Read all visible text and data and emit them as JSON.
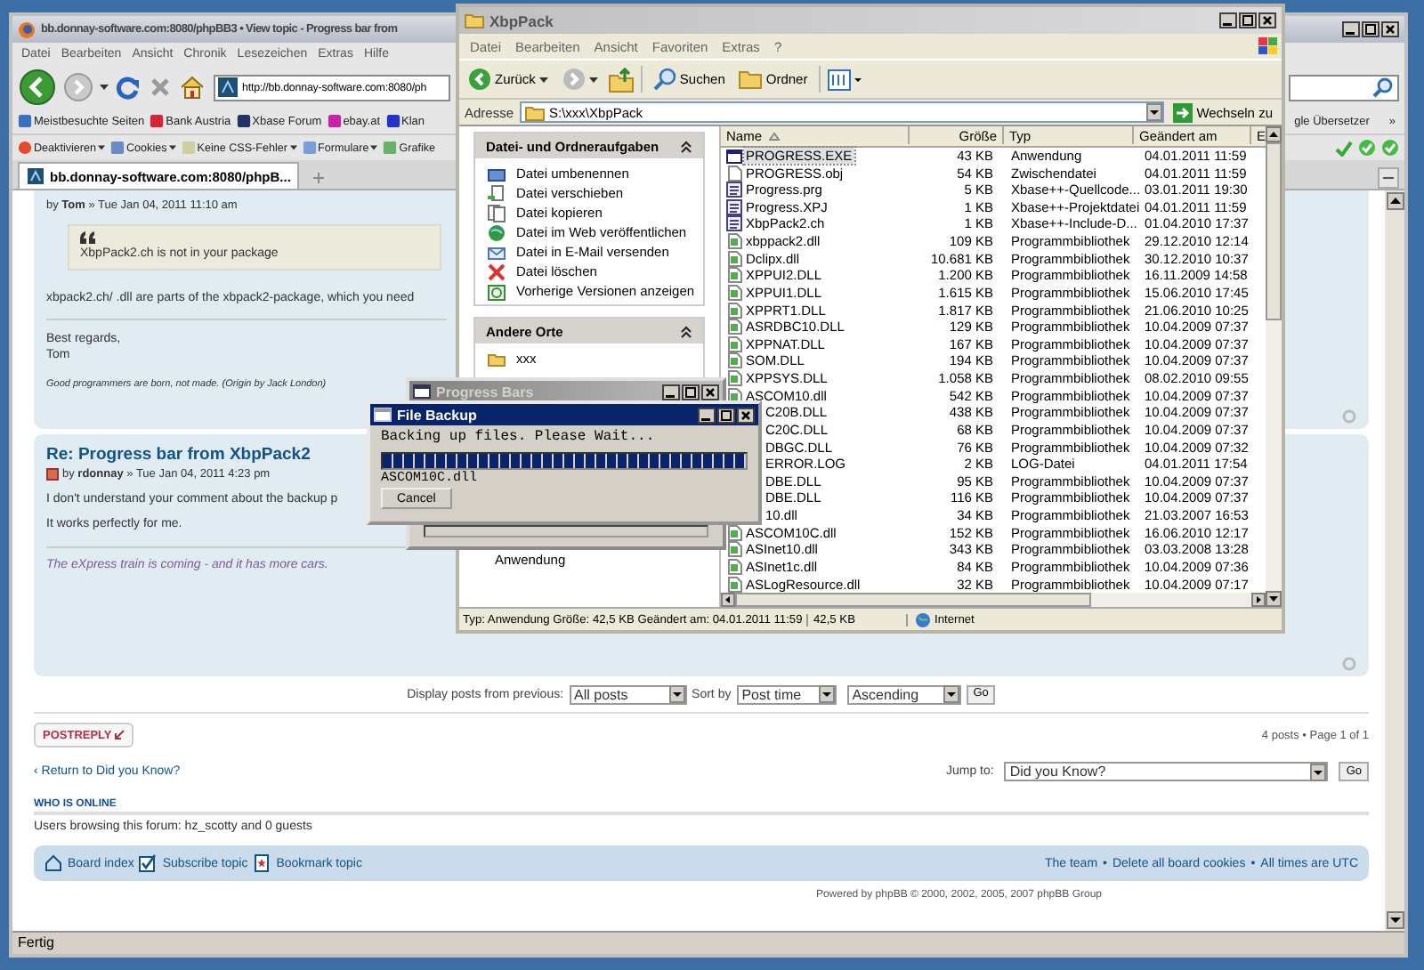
{
  "browser": {
    "title": "bb.donnay-software.com:8080/phpBB3 • View topic - Progress bar from",
    "menu": [
      "Datei",
      "Bearbeiten",
      "Ansicht",
      "Chronik",
      "Lesezeichen",
      "Extras",
      "Hilfe"
    ],
    "url": "http://bb.donnay-software.com:8080/ph",
    "bookmarks": [
      "Meistbesuchte Seiten",
      "Bank Austria",
      "Xbase Forum",
      "ebay.at",
      "Klan"
    ],
    "bookmarks_right": "gle Übersetzer",
    "bookmarks_more": "»",
    "devtools": [
      "Deaktivieren",
      "Cookies",
      "Keine CSS-Fehler",
      "Formulare",
      "Grafike"
    ],
    "tab": {
      "label": "bb.donnay-software.com:8080/phpB...",
      "selected": true
    },
    "status": "Fertig"
  },
  "forum": {
    "posts": [
      {
        "byline": "by **Tom** » Tue Jan 04, 2011 11:10 am",
        "quote": "XbpPack2.ch is not in your package",
        "paragraphs": [
          "xbpack2.ch/ .dll are parts of the xbpack2-package, which you need"
        ],
        "signature": [
          {
            "kind": "plain",
            "text": "Best regards,\nTom"
          },
          {
            "kind": "small_italic",
            "text": "Good programmers are born, not made. (Origin by Jack London)"
          }
        ]
      },
      {
        "title": "Re: Progress bar from XbpPack2",
        "byline": "by **rdonnay** » Tue Jan 04, 2011 4:23 pm",
        "paragraphs": [
          "I don't understand your comment about the backup p",
          "It works perfectly for me."
        ],
        "signature": [
          {
            "kind": "colored_italic",
            "text": "The eXpress train is coming - and it has more cars."
          }
        ]
      }
    ],
    "sort": {
      "label": "Display posts from previous:",
      "range": "All posts",
      "sort_label": "Sort by",
      "sort_key": "Post time",
      "order": "Ascending",
      "go": "Go"
    },
    "post_reply": "POSTREPLY",
    "pagination": "4 posts • Page 1 of 1",
    "return_link": "‹ Return to Did you Know?",
    "jump": {
      "label": "Jump to:",
      "value": "Did you Know?",
      "go": "Go"
    },
    "online": {
      "heading": "WHO IS ONLINE",
      "text": "Users browsing this forum: hz_scotty and 0 guests"
    },
    "footer": {
      "left": [
        {
          "kind": "home",
          "label": "Board index"
        },
        {
          "kind": "subscribe",
          "label": "Subscribe topic"
        },
        {
          "kind": "bookmark",
          "label": "Bookmark topic"
        }
      ],
      "right": [
        "The team",
        "Delete all board cookies",
        "All times are UTC"
      ],
      "separator": "•"
    },
    "powered": "Powered by phpBB © 2000, 2002, 2005, 2007 phpBB Group"
  },
  "explorer": {
    "title": "XbpPack",
    "menu": [
      "Datei",
      "Bearbeiten",
      "Ansicht",
      "Favoriten",
      "Extras",
      "?"
    ],
    "back": "Zurück",
    "search": "Suchen",
    "folders": "Ordner",
    "address_label": "Adresse",
    "address": "S:\\xxx\\XbpPack",
    "go": "Wechseln zu",
    "panels": [
      {
        "title": "Datei- und Ordneraufgaben",
        "expanded": true,
        "items": [
          {
            "kind": "rename",
            "label": "Datei umbenennen"
          },
          {
            "kind": "move",
            "label": "Datei verschieben"
          },
          {
            "kind": "copy",
            "label": "Datei kopieren"
          },
          {
            "kind": "web",
            "label": "Datei im Web veröffentlichen"
          },
          {
            "kind": "mail",
            "label": "Datei in E-Mail versenden"
          },
          {
            "kind": "delete",
            "label": "Datei löschen"
          },
          {
            "kind": "history",
            "label": "Vorherige Versionen anzeigen"
          }
        ]
      },
      {
        "title": "Andere Orte",
        "expanded": true,
        "items": [
          {
            "kind": "folder",
            "label": "xxx"
          }
        ]
      }
    ],
    "details": "Anwendung",
    "columns": [
      "Name",
      "Größe",
      "Typ",
      "Geändert am",
      "E"
    ],
    "files": [
      {
        "kind": "app",
        "name": "PROGRESS.EXE",
        "size": "43 KB",
        "type": "Anwendung",
        "modified": "04.01.2011 11:59",
        "selected": true
      },
      {
        "kind": "object",
        "name": "PROGRESS.obj",
        "size": "54 KB",
        "type": "Zwischendatei",
        "modified": "04.01.2011 11:59",
        "selected": false
      },
      {
        "kind": "source",
        "name": "Progress.prg",
        "size": "5 KB",
        "type": "Xbase++-Quellcode...",
        "modified": "03.01.2011 19:30",
        "selected": false
      },
      {
        "kind": "source",
        "name": "Progress.XPJ",
        "size": "1 KB",
        "type": "Xbase++-Projektdatei",
        "modified": "04.01.2011 11:59",
        "selected": false
      },
      {
        "kind": "source",
        "name": "XbpPack2.ch",
        "size": "1 KB",
        "type": "Xbase++-Include-D...",
        "modified": "01.04.2010 17:37",
        "selected": false
      },
      {
        "kind": "library",
        "name": "xbppack2.dll",
        "size": "109 KB",
        "type": "Programmbibliothek",
        "modified": "29.12.2010 12:14",
        "selected": false
      },
      {
        "kind": "library",
        "name": "Dclipx.dll",
        "size": "10.681 KB",
        "type": "Programmbibliothek",
        "modified": "30.12.2010 10:37",
        "selected": false
      },
      {
        "kind": "library",
        "name": "XPPUI2.DLL",
        "size": "1.200 KB",
        "type": "Programmbibliothek",
        "modified": "16.11.2009 14:58",
        "selected": false
      },
      {
        "kind": "library",
        "name": "XPPUI1.DLL",
        "size": "1.615 KB",
        "type": "Programmbibliothek",
        "modified": "15.06.2010 17:45",
        "selected": false
      },
      {
        "kind": "library",
        "name": "XPPRT1.DLL",
        "size": "1.817 KB",
        "type": "Programmbibliothek",
        "modified": "21.06.2010 10:25",
        "selected": false
      },
      {
        "kind": "library",
        "name": "ASRDBC10.DLL",
        "size": "129 KB",
        "type": "Programmbibliothek",
        "modified": "10.04.2009 07:37",
        "selected": false
      },
      {
        "kind": "library",
        "name": "XPPNAT.DLL",
        "size": "167 KB",
        "type": "Programmbibliothek",
        "modified": "10.04.2009 07:37",
        "selected": false
      },
      {
        "kind": "library",
        "name": "SOM.DLL",
        "size": "194 KB",
        "type": "Programmbibliothek",
        "modified": "10.04.2009 07:37",
        "selected": false
      },
      {
        "kind": "library",
        "name": "XPPSYS.DLL",
        "size": "1.058 KB",
        "type": "Programmbibliothek",
        "modified": "08.02.2010 09:55",
        "selected": false
      },
      {
        "kind": "library",
        "name": "ASCOM10.dll",
        "size": "542 KB",
        "type": "Programmbibliothek",
        "modified": "10.04.2009 07:37",
        "selected": false
      },
      {
        "kind": "hidden",
        "name": "C20B.DLL",
        "size": "438 KB",
        "type": "Programmbibliothek",
        "modified": "10.04.2009 07:37",
        "selected": false
      },
      {
        "kind": "hidden",
        "name": "C20C.DLL",
        "size": "68 KB",
        "type": "Programmbibliothek",
        "modified": "10.04.2009 07:37",
        "selected": false
      },
      {
        "kind": "hidden",
        "name": "DBGC.DLL",
        "size": "76 KB",
        "type": "Programmbibliothek",
        "modified": "10.04.2009 07:32",
        "selected": false
      },
      {
        "kind": "hidden",
        "name": "ERROR.LOG",
        "size": "2 KB",
        "type": "LOG-Datei",
        "modified": "04.01.2011 17:54",
        "selected": false
      },
      {
        "kind": "hidden",
        "name": "DBE.DLL",
        "size": "95 KB",
        "type": "Programmbibliothek",
        "modified": "10.04.2009 07:37",
        "selected": false
      },
      {
        "kind": "hidden",
        "name": "DBE.DLL",
        "size": "116 KB",
        "type": "Programmbibliothek",
        "modified": "10.04.2009 07:37",
        "selected": false
      },
      {
        "kind": "hidden",
        "name": "10.dll",
        "size": "34 KB",
        "type": "Programmbibliothek",
        "modified": "21.03.2007 16:53",
        "selected": false
      },
      {
        "kind": "library",
        "name": "ASCOM10C.dll",
        "size": "152 KB",
        "type": "Programmbibliothek",
        "modified": "16.06.2010 12:17",
        "selected": false
      },
      {
        "kind": "library",
        "name": "ASInet10.dll",
        "size": "343 KB",
        "type": "Programmbibliothek",
        "modified": "03.03.2008 13:28",
        "selected": false
      },
      {
        "kind": "library",
        "name": "ASInet1c.dll",
        "size": "84 KB",
        "type": "Programmbibliothek",
        "modified": "10.04.2009 07:36",
        "selected": false
      },
      {
        "kind": "library",
        "name": "ASLogResource.dll",
        "size": "32 KB",
        "type": "Programmbibliothek",
        "modified": "10.04.2009 07:17",
        "selected": false
      }
    ],
    "status": [
      "Typ: Anwendung Größe: 42,5 KB Geändert am: 04.01.2011 11:59",
      "42,5 KB",
      "Internet"
    ]
  },
  "progress_window": {
    "title": "Progress Bars"
  },
  "backup_dialog": {
    "title": "File Backup",
    "message": "Backing up files. Please Wait...",
    "level": 1,
    "file": "ASCOM10C.dll",
    "cancel": "Cancel"
  }
}
